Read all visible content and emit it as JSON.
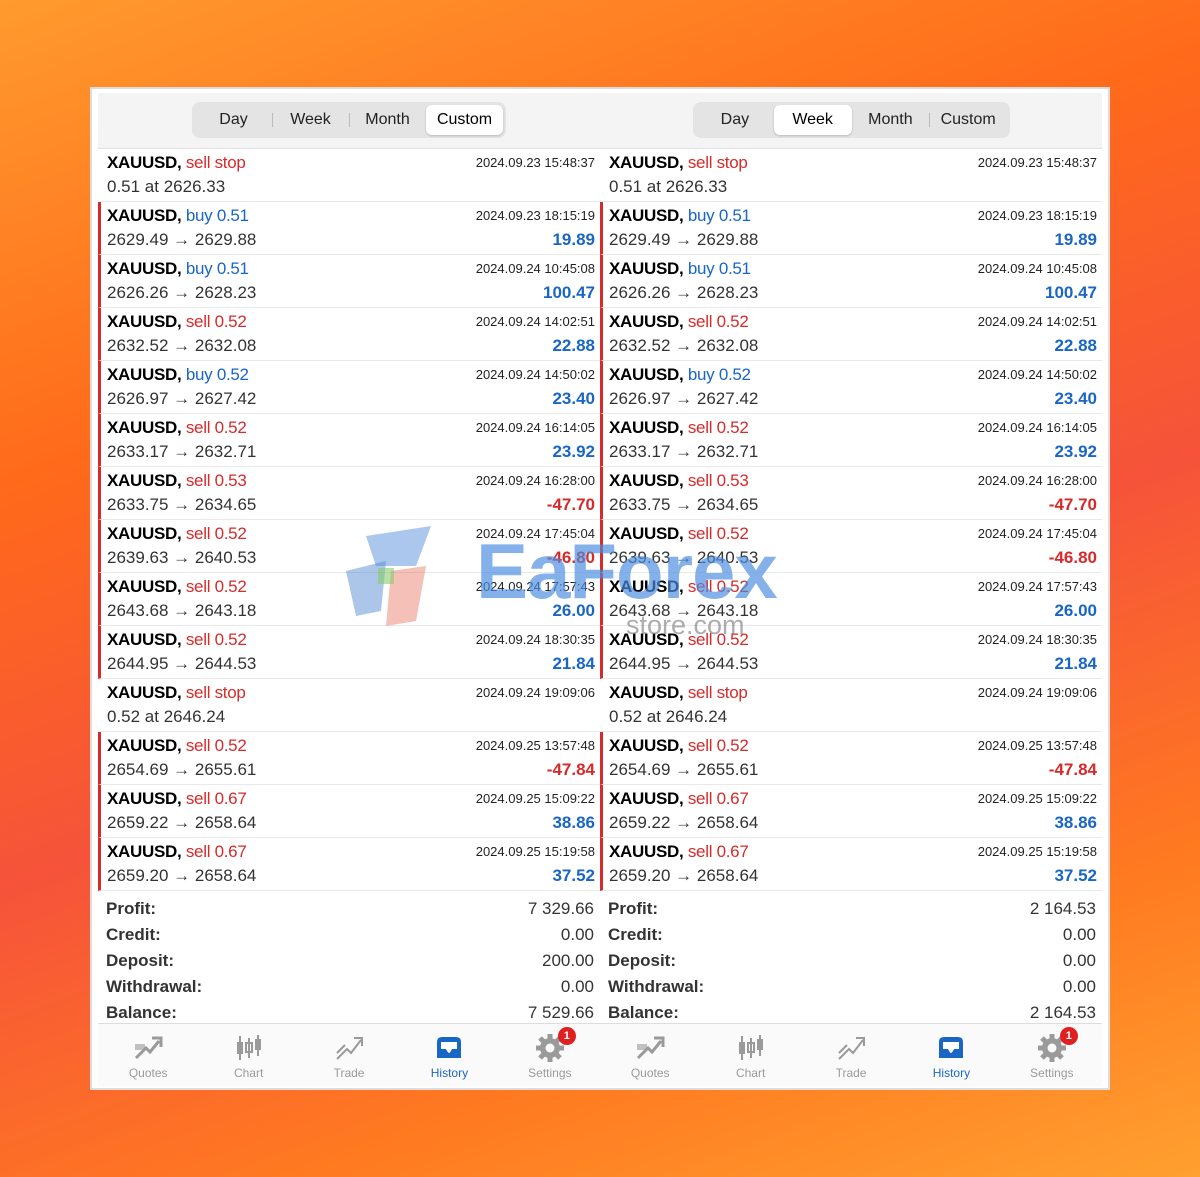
{
  "segments": [
    "Day",
    "Week",
    "Month",
    "Custom"
  ],
  "panels": [
    {
      "active_segment": "Custom",
      "rows": [
        {
          "kind": "order",
          "symbol": "XAUUSD,",
          "type": "sell stop",
          "side": "sell",
          "volume": "",
          "line2": "0.51 at 2626.33",
          "time": "2024.09.23 15:48:37",
          "profit": ""
        },
        {
          "kind": "deal",
          "symbol": "XAUUSD,",
          "type": "buy",
          "side": "buy",
          "volume": "0.51",
          "line2": "2629.49 → 2629.88",
          "time": "2024.09.23 18:15:19",
          "profit": "19.89"
        },
        {
          "kind": "deal",
          "symbol": "XAUUSD,",
          "type": "buy",
          "side": "buy",
          "volume": "0.51",
          "line2": "2626.26 → 2628.23",
          "time": "2024.09.24 10:45:08",
          "profit": "100.47"
        },
        {
          "kind": "deal",
          "symbol": "XAUUSD,",
          "type": "sell",
          "side": "sell",
          "volume": "0.52",
          "line2": "2632.52 → 2632.08",
          "time": "2024.09.24 14:02:51",
          "profit": "22.88"
        },
        {
          "kind": "deal",
          "symbol": "XAUUSD,",
          "type": "buy",
          "side": "buy",
          "volume": "0.52",
          "line2": "2626.97 → 2627.42",
          "time": "2024.09.24 14:50:02",
          "profit": "23.40"
        },
        {
          "kind": "deal",
          "symbol": "XAUUSD,",
          "type": "sell",
          "side": "sell",
          "volume": "0.52",
          "line2": "2633.17 → 2632.71",
          "time": "2024.09.24 16:14:05",
          "profit": "23.92"
        },
        {
          "kind": "deal",
          "symbol": "XAUUSD,",
          "type": "sell",
          "side": "sell",
          "volume": "0.53",
          "line2": "2633.75 → 2634.65",
          "time": "2024.09.24 16:28:00",
          "profit": "-47.70"
        },
        {
          "kind": "deal",
          "symbol": "XAUUSD,",
          "type": "sell",
          "side": "sell",
          "volume": "0.52",
          "line2": "2639.63 → 2640.53",
          "time": "2024.09.24 17:45:04",
          "profit": "-46.80"
        },
        {
          "kind": "deal",
          "symbol": "XAUUSD,",
          "type": "sell",
          "side": "sell",
          "volume": "0.52",
          "line2": "2643.68 → 2643.18",
          "time": "2024.09.24 17:57:43",
          "profit": "26.00"
        },
        {
          "kind": "deal",
          "symbol": "XAUUSD,",
          "type": "sell",
          "side": "sell",
          "volume": "0.52",
          "line2": "2644.95 → 2644.53",
          "time": "2024.09.24 18:30:35",
          "profit": "21.84"
        },
        {
          "kind": "order",
          "symbol": "XAUUSD,",
          "type": "sell stop",
          "side": "sell",
          "volume": "",
          "line2": "0.52 at 2646.24",
          "time": "2024.09.24 19:09:06",
          "profit": ""
        },
        {
          "kind": "deal",
          "symbol": "XAUUSD,",
          "type": "sell",
          "side": "sell",
          "volume": "0.52",
          "line2": "2654.69 → 2655.61",
          "time": "2024.09.25 13:57:48",
          "profit": "-47.84"
        },
        {
          "kind": "deal",
          "symbol": "XAUUSD,",
          "type": "sell",
          "side": "sell",
          "volume": "0.67",
          "line2": "2659.22 → 2658.64",
          "time": "2024.09.25 15:09:22",
          "profit": "38.86"
        },
        {
          "kind": "deal",
          "symbol": "XAUUSD,",
          "type": "sell",
          "side": "sell",
          "volume": "0.67",
          "line2": "2659.20 → 2658.64",
          "time": "2024.09.25 15:19:58",
          "profit": "37.52"
        }
      ],
      "summary": [
        {
          "label": "Profit:",
          "value": "7 329.66"
        },
        {
          "label": "Credit:",
          "value": "0.00"
        },
        {
          "label": "Deposit:",
          "value": "200.00"
        },
        {
          "label": "Withdrawal:",
          "value": "0.00"
        },
        {
          "label": "Balance:",
          "value": "7 529.66"
        }
      ]
    },
    {
      "active_segment": "Week",
      "rows": [
        {
          "kind": "order",
          "symbol": "XAUUSD,",
          "type": "sell stop",
          "side": "sell",
          "volume": "",
          "line2": "0.51 at 2626.33",
          "time": "2024.09.23 15:48:37",
          "profit": ""
        },
        {
          "kind": "deal",
          "symbol": "XAUUSD,",
          "type": "buy",
          "side": "buy",
          "volume": "0.51",
          "line2": "2629.49 → 2629.88",
          "time": "2024.09.23 18:15:19",
          "profit": "19.89"
        },
        {
          "kind": "deal",
          "symbol": "XAUUSD,",
          "type": "buy",
          "side": "buy",
          "volume": "0.51",
          "line2": "2626.26 → 2628.23",
          "time": "2024.09.24 10:45:08",
          "profit": "100.47"
        },
        {
          "kind": "deal",
          "symbol": "XAUUSD,",
          "type": "sell",
          "side": "sell",
          "volume": "0.52",
          "line2": "2632.52 → 2632.08",
          "time": "2024.09.24 14:02:51",
          "profit": "22.88"
        },
        {
          "kind": "deal",
          "symbol": "XAUUSD,",
          "type": "buy",
          "side": "buy",
          "volume": "0.52",
          "line2": "2626.97 → 2627.42",
          "time": "2024.09.24 14:50:02",
          "profit": "23.40"
        },
        {
          "kind": "deal",
          "symbol": "XAUUSD,",
          "type": "sell",
          "side": "sell",
          "volume": "0.52",
          "line2": "2633.17 → 2632.71",
          "time": "2024.09.24 16:14:05",
          "profit": "23.92"
        },
        {
          "kind": "deal",
          "symbol": "XAUUSD,",
          "type": "sell",
          "side": "sell",
          "volume": "0.53",
          "line2": "2633.75 → 2634.65",
          "time": "2024.09.24 16:28:00",
          "profit": "-47.70"
        },
        {
          "kind": "deal",
          "symbol": "XAUUSD,",
          "type": "sell",
          "side": "sell",
          "volume": "0.52",
          "line2": "2639.63 → 2640.53",
          "time": "2024.09.24 17:45:04",
          "profit": "-46.80"
        },
        {
          "kind": "deal",
          "symbol": "XAUUSD,",
          "type": "sell",
          "side": "sell",
          "volume": "0.52",
          "line2": "2643.68 → 2643.18",
          "time": "2024.09.24 17:57:43",
          "profit": "26.00"
        },
        {
          "kind": "deal",
          "symbol": "XAUUSD,",
          "type": "sell",
          "side": "sell",
          "volume": "0.52",
          "line2": "2644.95 → 2644.53",
          "time": "2024.09.24 18:30:35",
          "profit": "21.84"
        },
        {
          "kind": "order",
          "symbol": "XAUUSD,",
          "type": "sell stop",
          "side": "sell",
          "volume": "",
          "line2": "0.52 at 2646.24",
          "time": "2024.09.24 19:09:06",
          "profit": ""
        },
        {
          "kind": "deal",
          "symbol": "XAUUSD,",
          "type": "sell",
          "side": "sell",
          "volume": "0.52",
          "line2": "2654.69 → 2655.61",
          "time": "2024.09.25 13:57:48",
          "profit": "-47.84"
        },
        {
          "kind": "deal",
          "symbol": "XAUUSD,",
          "type": "sell",
          "side": "sell",
          "volume": "0.67",
          "line2": "2659.22 → 2658.64",
          "time": "2024.09.25 15:09:22",
          "profit": "38.86"
        },
        {
          "kind": "deal",
          "symbol": "XAUUSD,",
          "type": "sell",
          "side": "sell",
          "volume": "0.67",
          "line2": "2659.20 → 2658.64",
          "time": "2024.09.25 15:19:58",
          "profit": "37.52"
        }
      ],
      "summary": [
        {
          "label": "Profit:",
          "value": "2 164.53"
        },
        {
          "label": "Credit:",
          "value": "0.00"
        },
        {
          "label": "Deposit:",
          "value": "0.00"
        },
        {
          "label": "Withdrawal:",
          "value": "0.00"
        },
        {
          "label": "Balance:",
          "value": "2 164.53"
        }
      ]
    }
  ],
  "tabs": [
    {
      "label": "Quotes",
      "icon": "quotes-icon",
      "active": false,
      "badge": ""
    },
    {
      "label": "Chart",
      "icon": "candlestick-chart-icon",
      "active": false,
      "badge": ""
    },
    {
      "label": "Trade",
      "icon": "trade-icon",
      "active": false,
      "badge": ""
    },
    {
      "label": "History",
      "icon": "history-tray-icon",
      "active": true,
      "badge": ""
    },
    {
      "label": "Settings",
      "icon": "gear-icon",
      "active": false,
      "badge": "1"
    }
  ],
  "watermark": {
    "brand": "EaForex",
    "sub": "store.com"
  },
  "colors": {
    "sell": "#d52b2b",
    "buy": "#1a66c4",
    "active_tab": "#1a66c4"
  }
}
